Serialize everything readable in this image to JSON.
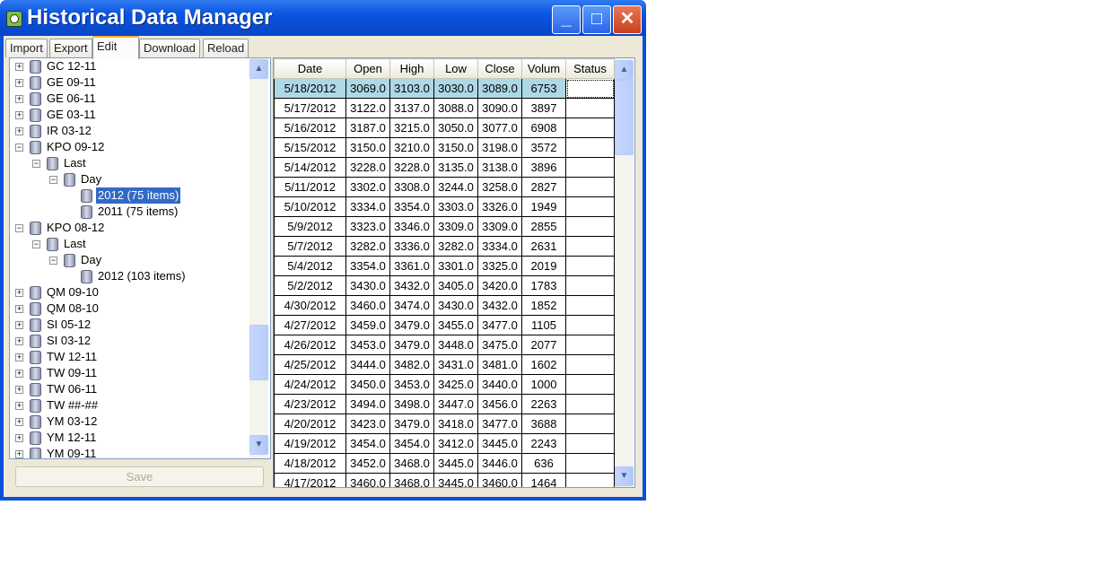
{
  "window": {
    "title": "Historical Data Manager",
    "minimize": "_",
    "maximize": "□",
    "close": "✕"
  },
  "tabs": [
    {
      "label": "Import"
    },
    {
      "label": "Export"
    },
    {
      "label": "Edit"
    },
    {
      "label": "Download"
    },
    {
      "label": "Reload"
    }
  ],
  "active_tab": "Edit",
  "tree": [
    {
      "label": "GC 12-11",
      "level": 0,
      "expander": "+"
    },
    {
      "label": "GE 09-11",
      "level": 0,
      "expander": "+"
    },
    {
      "label": "GE 06-11",
      "level": 0,
      "expander": "+"
    },
    {
      "label": "GE 03-11",
      "level": 0,
      "expander": "+"
    },
    {
      "label": "IR 03-12",
      "level": 0,
      "expander": "+"
    },
    {
      "label": "KPO 09-12",
      "level": 0,
      "expander": "−"
    },
    {
      "label": "Last",
      "level": 1,
      "expander": "−"
    },
    {
      "label": "Day",
      "level": 2,
      "expander": "−"
    },
    {
      "label": "2012 (75 items)",
      "level": 3,
      "expander": "",
      "selected": true
    },
    {
      "label": "2011 (75 items)",
      "level": 3,
      "expander": ""
    },
    {
      "label": "KPO 08-12",
      "level": 0,
      "expander": "−"
    },
    {
      "label": "Last",
      "level": 1,
      "expander": "−"
    },
    {
      "label": "Day",
      "level": 2,
      "expander": "−"
    },
    {
      "label": "2012 (103 items)",
      "level": 3,
      "expander": ""
    },
    {
      "label": "QM 09-10",
      "level": 0,
      "expander": "+"
    },
    {
      "label": "QM 08-10",
      "level": 0,
      "expander": "+"
    },
    {
      "label": "SI 05-12",
      "level": 0,
      "expander": "+"
    },
    {
      "label": "SI 03-12",
      "level": 0,
      "expander": "+"
    },
    {
      "label": "TW 12-11",
      "level": 0,
      "expander": "+"
    },
    {
      "label": "TW 09-11",
      "level": 0,
      "expander": "+"
    },
    {
      "label": "TW 06-11",
      "level": 0,
      "expander": "+"
    },
    {
      "label": "TW ##-##",
      "level": 0,
      "expander": "+"
    },
    {
      "label": "YM 03-12",
      "level": 0,
      "expander": "+"
    },
    {
      "label": "YM 12-11",
      "level": 0,
      "expander": "+"
    },
    {
      "label": "YM 09-11",
      "level": 0,
      "expander": "+"
    }
  ],
  "save_label": "Save",
  "grid": {
    "columns": [
      "Date",
      "Open",
      "High",
      "Low",
      "Close",
      "Volum",
      "Status"
    ],
    "rows": [
      [
        "5/18/2012",
        "3069.0",
        "3103.0",
        "3030.0",
        "3089.0",
        "6753",
        ""
      ],
      [
        "5/17/2012",
        "3122.0",
        "3137.0",
        "3088.0",
        "3090.0",
        "3897",
        ""
      ],
      [
        "5/16/2012",
        "3187.0",
        "3215.0",
        "3050.0",
        "3077.0",
        "6908",
        ""
      ],
      [
        "5/15/2012",
        "3150.0",
        "3210.0",
        "3150.0",
        "3198.0",
        "3572",
        ""
      ],
      [
        "5/14/2012",
        "3228.0",
        "3228.0",
        "3135.0",
        "3138.0",
        "3896",
        ""
      ],
      [
        "5/11/2012",
        "3302.0",
        "3308.0",
        "3244.0",
        "3258.0",
        "2827",
        ""
      ],
      [
        "5/10/2012",
        "3334.0",
        "3354.0",
        "3303.0",
        "3326.0",
        "1949",
        ""
      ],
      [
        "5/9/2012",
        "3323.0",
        "3346.0",
        "3309.0",
        "3309.0",
        "2855",
        ""
      ],
      [
        "5/7/2012",
        "3282.0",
        "3336.0",
        "3282.0",
        "3334.0",
        "2631",
        ""
      ],
      [
        "5/4/2012",
        "3354.0",
        "3361.0",
        "3301.0",
        "3325.0",
        "2019",
        ""
      ],
      [
        "5/2/2012",
        "3430.0",
        "3432.0",
        "3405.0",
        "3420.0",
        "1783",
        ""
      ],
      [
        "4/30/2012",
        "3460.0",
        "3474.0",
        "3430.0",
        "3432.0",
        "1852",
        ""
      ],
      [
        "4/27/2012",
        "3459.0",
        "3479.0",
        "3455.0",
        "3477.0",
        "1105",
        ""
      ],
      [
        "4/26/2012",
        "3453.0",
        "3479.0",
        "3448.0",
        "3475.0",
        "2077",
        ""
      ],
      [
        "4/25/2012",
        "3444.0",
        "3482.0",
        "3431.0",
        "3481.0",
        "1602",
        ""
      ],
      [
        "4/24/2012",
        "3450.0",
        "3453.0",
        "3425.0",
        "3440.0",
        "1000",
        ""
      ],
      [
        "4/23/2012",
        "3494.0",
        "3498.0",
        "3447.0",
        "3456.0",
        "2263",
        ""
      ],
      [
        "4/20/2012",
        "3423.0",
        "3479.0",
        "3418.0",
        "3477.0",
        "3688",
        ""
      ],
      [
        "4/19/2012",
        "3454.0",
        "3454.0",
        "3412.0",
        "3445.0",
        "2243",
        ""
      ],
      [
        "4/18/2012",
        "3452.0",
        "3468.0",
        "3445.0",
        "3446.0",
        "636",
        ""
      ],
      [
        "4/17/2012",
        "3460.0",
        "3468.0",
        "3445.0",
        "3460.0",
        "1464",
        ""
      ]
    ]
  }
}
